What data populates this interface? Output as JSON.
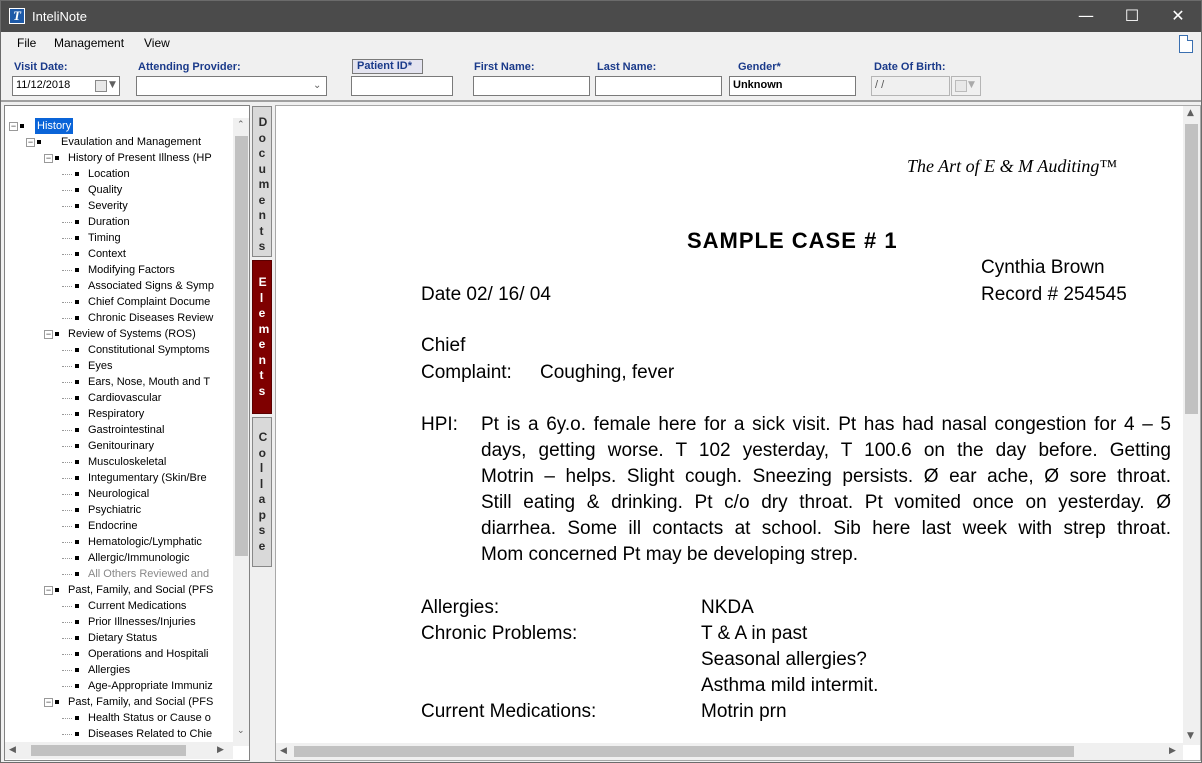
{
  "window": {
    "title": "InteliNote",
    "icon_letter": "T"
  },
  "menu": [
    "File",
    "Management",
    "View"
  ],
  "header": {
    "visit_date": {
      "label": "Visit Date:",
      "value": "11/12/2018"
    },
    "attending_provider": {
      "label": "Attending Provider:",
      "value": ""
    },
    "patient_id": {
      "label": "Patient ID*",
      "value": ""
    },
    "first_name": {
      "label": "First Name:",
      "value": ""
    },
    "last_name": {
      "label": "Last Name:",
      "value": ""
    },
    "gender": {
      "label": "Gender*",
      "value": "Unknown"
    },
    "dob": {
      "label": "Date Of Birth:",
      "value": " / /"
    }
  },
  "tabs": {
    "documents": "Documents",
    "elements": "Elements",
    "collapse": "Collapse"
  },
  "tree": [
    {
      "label": "History",
      "level": 0,
      "expander": "minus",
      "selected": true
    },
    {
      "label": "Evaulation and Management",
      "level": 1,
      "expander": "minus"
    },
    {
      "label": "History of Present Illness (HP",
      "level": 2,
      "expander": "minus"
    },
    {
      "label": "Location",
      "level": 3
    },
    {
      "label": "Quality",
      "level": 3
    },
    {
      "label": "Severity",
      "level": 3
    },
    {
      "label": "Duration",
      "level": 3
    },
    {
      "label": "Timing",
      "level": 3
    },
    {
      "label": "Context",
      "level": 3
    },
    {
      "label": "Modifying Factors",
      "level": 3
    },
    {
      "label": "Associated Signs & Symp",
      "level": 3
    },
    {
      "label": "Chief Complaint Docume",
      "level": 3
    },
    {
      "label": "Chronic Diseases Review",
      "level": 3
    },
    {
      "label": "Review of Systems (ROS)",
      "level": 2,
      "expander": "minus"
    },
    {
      "label": "Constitutional Symptoms",
      "level": 3
    },
    {
      "label": "Eyes",
      "level": 3
    },
    {
      "label": "Ears, Nose, Mouth and T",
      "level": 3
    },
    {
      "label": "Cardiovascular",
      "level": 3
    },
    {
      "label": "Respiratory",
      "level": 3
    },
    {
      "label": "Gastrointestinal",
      "level": 3
    },
    {
      "label": "Genitourinary",
      "level": 3
    },
    {
      "label": "Musculoskeletal",
      "level": 3
    },
    {
      "label": "Integumentary (Skin/Bre",
      "level": 3
    },
    {
      "label": "Neurological",
      "level": 3
    },
    {
      "label": "Psychiatric",
      "level": 3
    },
    {
      "label": "Endocrine",
      "level": 3
    },
    {
      "label": "Hematologic/Lymphatic",
      "level": 3
    },
    {
      "label": "Allergic/Immunologic",
      "level": 3
    },
    {
      "label": "All Others Reviewed and",
      "level": 3,
      "grayed": true
    },
    {
      "label": "Past, Family, and Social (PFS",
      "level": 2,
      "expander": "minus"
    },
    {
      "label": "Current Medications",
      "level": 3
    },
    {
      "label": "Prior Illnesses/Injuries",
      "level": 3
    },
    {
      "label": "Dietary Status",
      "level": 3
    },
    {
      "label": "Operations and Hospitali",
      "level": 3
    },
    {
      "label": "Allergies",
      "level": 3
    },
    {
      "label": "Age-Appropriate Immuniz",
      "level": 3
    },
    {
      "label": "Past, Family, and Social (PFS",
      "level": 2,
      "expander": "minus"
    },
    {
      "label": "Health Status or Cause o",
      "level": 3
    },
    {
      "label": "Diseases Related to Chie",
      "level": 3
    }
  ],
  "document": {
    "tagline": "The Art of E & M Auditing™",
    "title": "SAMPLE CASE # 1",
    "patient_name": "Cynthia Brown",
    "date": "Date 02/ 16/ 04",
    "record": "Record # 254545",
    "chief": "Chief",
    "complaint_label": "Complaint:",
    "complaint_value": "Coughing, fever",
    "hpi_label": "HPI:",
    "hpi_lines": [
      "Pt is a 6y.o. female  here for a sick visit.  Pt has had nasal congestion for 4 – 5",
      "days, getting worse.  T 102 yesterday, T 100.6 on the day before.  Getting",
      "Motrin – helps.  Slight cough.  Sneezing persists.  Ø  ear ache,  Ø  sore throat.",
      "Still eating & drinking.  Pt c/o dry throat.  Pt vomited once on yesterday.  Ø",
      "diarrhea.  Some ill contacts at school.  Sib here last week with strep throat.",
      "Mom concerned Pt may be developing strep."
    ],
    "allergies_label": "Allergies:",
    "allergies_value": "NKDA",
    "chronic_label": "Chronic Problems:",
    "chronic_values": [
      "T & A in past",
      "Seasonal allergies?",
      "Asthma mild intermit."
    ],
    "meds_label": "Current Medications:",
    "meds_value": "Motrin prn"
  }
}
